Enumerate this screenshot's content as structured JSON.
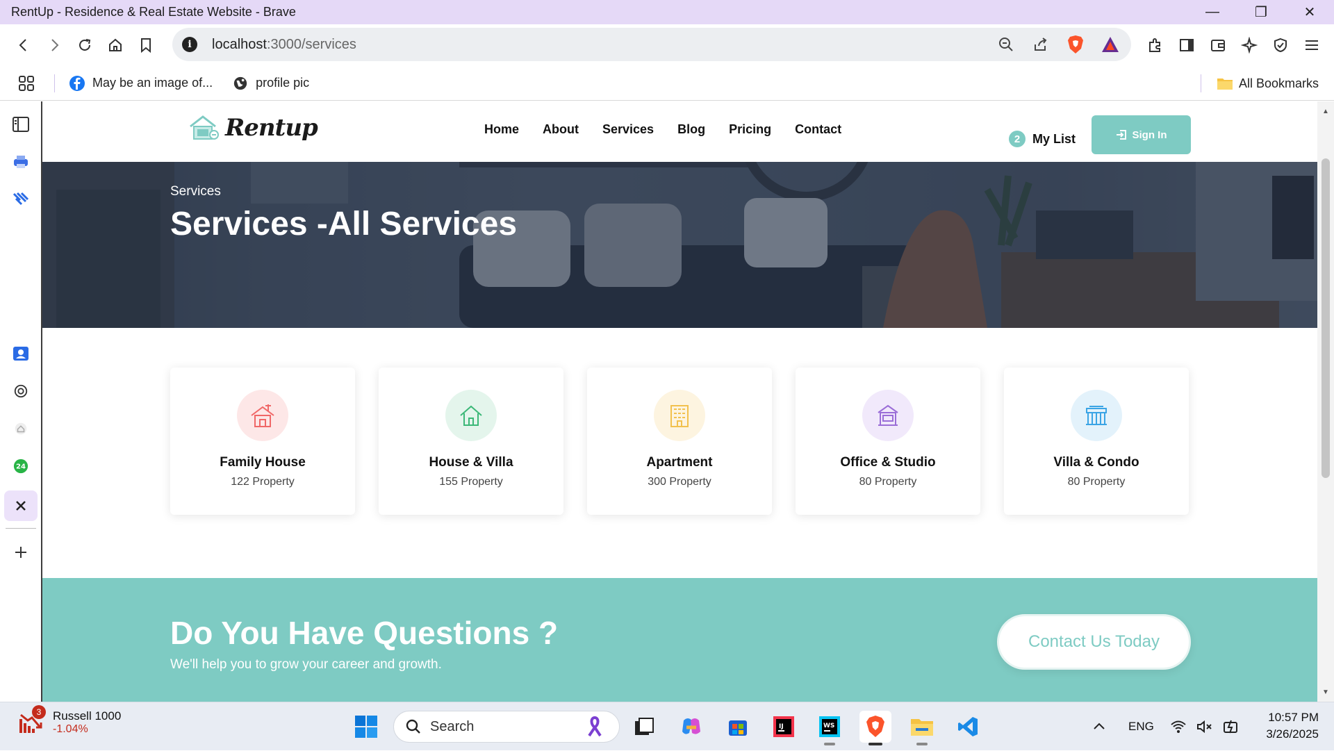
{
  "window": {
    "title": "RentUp - Residence & Real Estate Website - Brave"
  },
  "address_bar": {
    "host": "localhost",
    "path": ":3000/services"
  },
  "bookmarks": [
    {
      "label": "May be an image of...",
      "icon": "facebook-icon"
    },
    {
      "label": "profile pic",
      "icon": "globe-icon"
    }
  ],
  "bookmarks_all": "All Bookmarks",
  "site": {
    "logo_text": "Rentup",
    "nav": [
      "Home",
      "About",
      "Services",
      "Blog",
      "Pricing",
      "Contact"
    ],
    "my_list_count": "2",
    "my_list_label": "My List",
    "sign_in_label": "Sign In"
  },
  "hero": {
    "breadcrumb": "Services",
    "title": "Services -All Services"
  },
  "services": [
    {
      "name": "Family House",
      "count": "122 Property",
      "icon": "family-house-icon",
      "color": "#f06767",
      "bg": "#fde7e7"
    },
    {
      "name": "House & Villa",
      "count": "155 Property",
      "icon": "house-villa-icon",
      "color": "#3cb878",
      "bg": "#e4f5ec"
    },
    {
      "name": "Apartment",
      "count": "300 Property",
      "icon": "apartment-icon",
      "color": "#f2c14e",
      "bg": "#fdf4e0"
    },
    {
      "name": "Office & Studio",
      "count": "80 Property",
      "icon": "office-studio-icon",
      "color": "#9a6dd7",
      "bg": "#f1e9fb"
    },
    {
      "name": "Villa & Condo",
      "count": "80 Property",
      "icon": "villa-condo-icon",
      "color": "#3aa4e5",
      "bg": "#e3f2fb"
    }
  ],
  "cta": {
    "heading": "Do You Have Questions ?",
    "subtext": "We'll help you to grow your career and growth.",
    "button": "Contact Us Today"
  },
  "taskbar": {
    "stock_name": "Russell 1000",
    "stock_change": "-1.04%",
    "stock_badge": "3",
    "search_placeholder": "Search",
    "language": "ENG",
    "time": "10:57 PM",
    "date": "3/26/2025"
  },
  "colors": {
    "accent": "#7ecbc3",
    "titlebar": "#e5d9f7"
  }
}
